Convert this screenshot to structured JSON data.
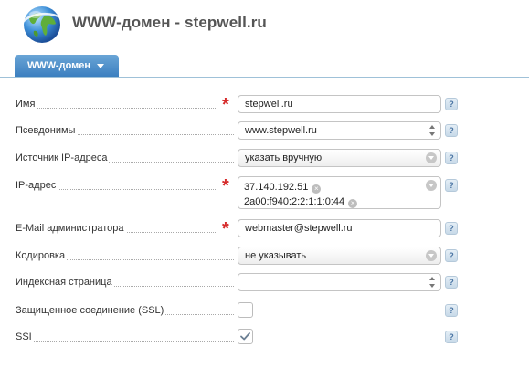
{
  "header": {
    "title": "WWW-домен - stepwell.ru",
    "logo_icon": "globe-icon"
  },
  "tabs": [
    {
      "label": "WWW-домен"
    }
  ],
  "form": {
    "name": {
      "label": "Имя",
      "value": "stepwell.ru",
      "required": true
    },
    "aliases": {
      "label": "Псевдонимы",
      "value": "www.stepwell.ru"
    },
    "ip_source": {
      "label": "Источник IP-адреса",
      "value": "указать вручную"
    },
    "ip_address": {
      "label": "IP-адрес",
      "values": [
        "37.140.192.51",
        "2a00:f940:2:2:1:1:0:44"
      ],
      "required": true
    },
    "admin_email": {
      "label": "E-Mail администратора",
      "value": "webmaster@stepwell.ru",
      "required": true
    },
    "charset": {
      "label": "Кодировка",
      "value": "не указывать"
    },
    "index_page": {
      "label": "Индексная страница",
      "value": ""
    },
    "ssl": {
      "label": "Защищенное соединение (SSL)",
      "checked": false
    },
    "ssi": {
      "label": "SSI",
      "checked": true
    }
  },
  "help_label": "?",
  "required_mark": "*",
  "remove_mark": "×",
  "colors": {
    "tab": "#3b7fc0",
    "required": "#d62a2a",
    "help": "#4a74a3"
  }
}
